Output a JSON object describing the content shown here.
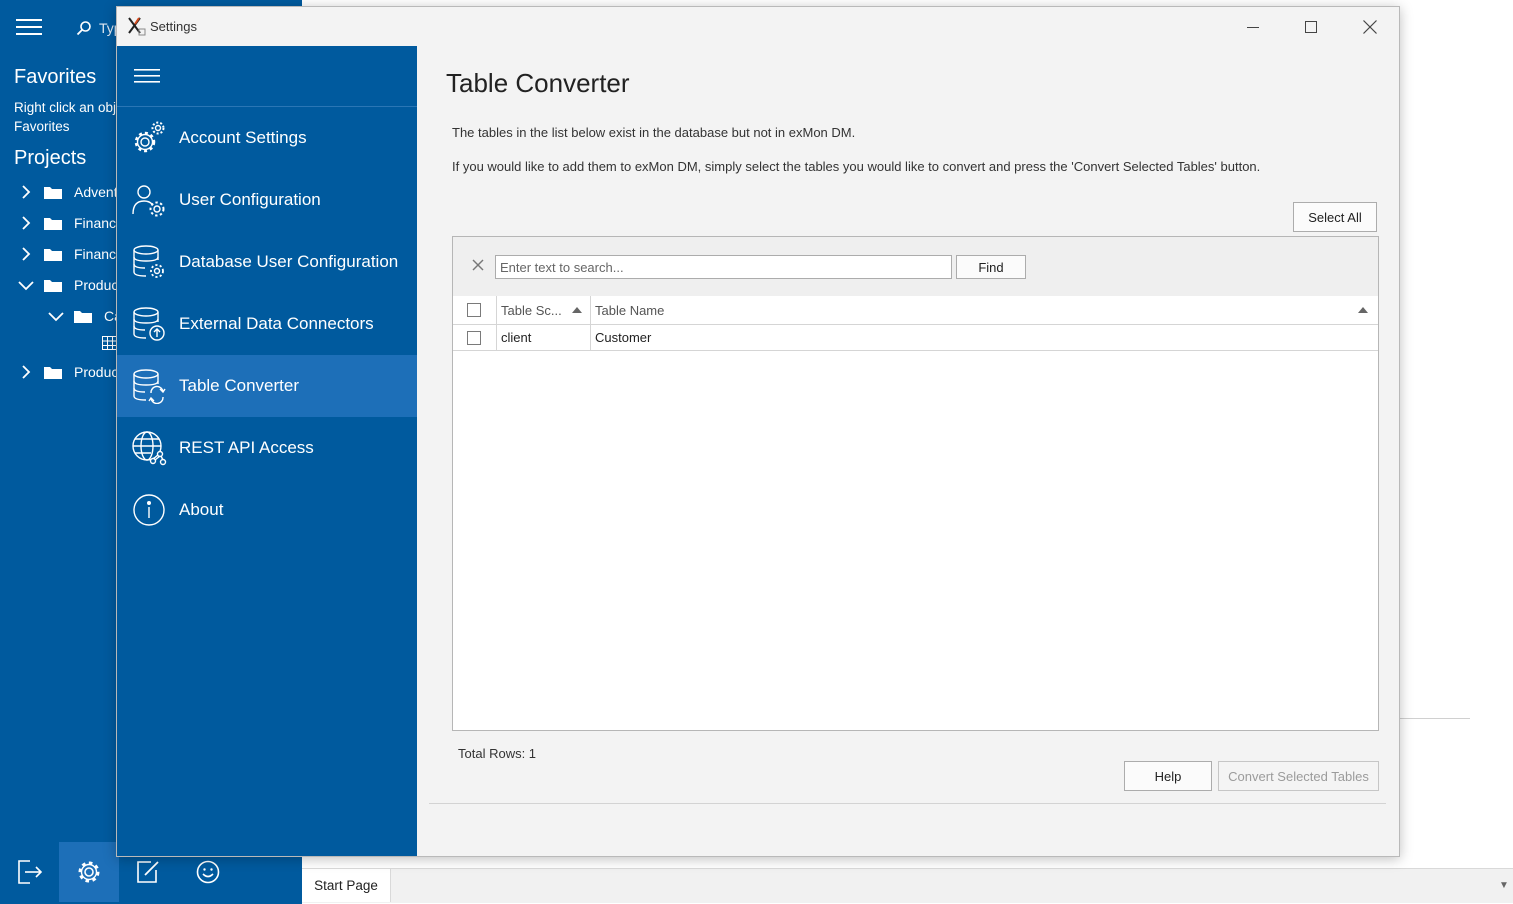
{
  "app": {
    "search_placeholder": "Typ",
    "favorites_heading": "Favorites",
    "favorites_hint_line1": "Right click an obj",
    "favorites_hint_line2": "Favorites",
    "projects_heading": "Projects",
    "tree": [
      {
        "label": "Advent",
        "expanded": false
      },
      {
        "label": "Finance",
        "expanded": false
      },
      {
        "label": "Finance",
        "expanded": false
      },
      {
        "label": "Produc",
        "expanded": true
      },
      {
        "label": "Ca",
        "expanded": true
      },
      {
        "label": "",
        "type": "table"
      },
      {
        "label": "Produc",
        "expanded": false
      }
    ],
    "bottom_icons": [
      "logout-icon",
      "gear-icon",
      "edit-icon",
      "smiley-icon"
    ],
    "start_tab": "Start Page",
    "accent_color": "#005a9e"
  },
  "window": {
    "title": "Settings",
    "controls": [
      "minimize-icon",
      "maximize-icon",
      "close-icon"
    ]
  },
  "nav": {
    "items": [
      {
        "label": "Account Settings",
        "icon": "gears-icon",
        "active": false
      },
      {
        "label": "User Configuration",
        "icon": "user-gear-icon",
        "active": false
      },
      {
        "label": "Database User Configuration",
        "icon": "database-user-icon",
        "active": false
      },
      {
        "label": "External Data Connectors",
        "icon": "database-upload-icon",
        "active": false
      },
      {
        "label": "Table Converter",
        "icon": "database-convert-icon",
        "active": true
      },
      {
        "label": "REST API Access",
        "icon": "globe-network-icon",
        "active": false
      },
      {
        "label": "About",
        "icon": "info-icon",
        "active": false
      }
    ],
    "active_color": "#1d6fb8"
  },
  "main": {
    "title": "Table Converter",
    "description1": "The tables in the list below exist in the database but not in exMon DM.",
    "description2": "If you would like to add them to exMon DM, simply select the tables you would like to convert and press the 'Convert Selected Tables' button.",
    "select_all": "Select All",
    "search": {
      "placeholder": "Enter text to search...",
      "value": "",
      "find_label": "Find"
    },
    "columns": [
      "Table Sc...",
      "Table Name"
    ],
    "rows": [
      {
        "schema": "client",
        "name": "Customer",
        "checked": false
      }
    ],
    "total_rows": "Total Rows: 1",
    "help_label": "Help",
    "convert_label": "Convert Selected Tables"
  }
}
